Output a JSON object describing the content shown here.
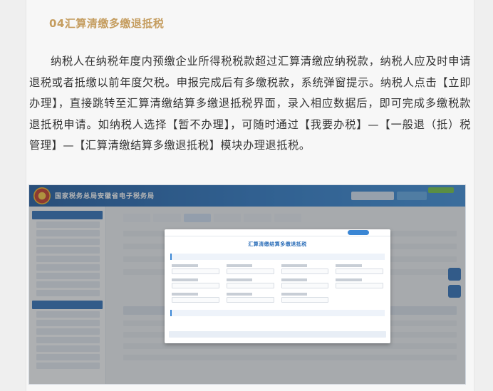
{
  "article": {
    "section_title": "04汇算清缴多缴退抵税",
    "paragraph": "纳税人在纳税年度内预缴企业所得税税款超过汇算清缴应纳税款，纳税人应及时申请退税或者抵缴以前年度欠税。申报完成后有多缴税款，系统弹窗提示。纳税人点击【立即办理】，直接跳转至汇算清缴结算多缴退抵税界面，录入相应数据后，即可完成多缴税款退抵税申请。如纳税人选择【暂不办理】，可随时通过【我要办税】—【一般退（抵）税管理】—【汇算清缴结算多缴退抵税】模块办理退抵税。"
  },
  "screenshot": {
    "site_title": "国家税务总局安徽省电子税务局",
    "modal_title": "汇算清缴结算多缴退抵税",
    "emblem_icon": "national-emblem",
    "colors": {
      "header": "#2b78c6",
      "accent_title": "#c59d5f"
    }
  }
}
